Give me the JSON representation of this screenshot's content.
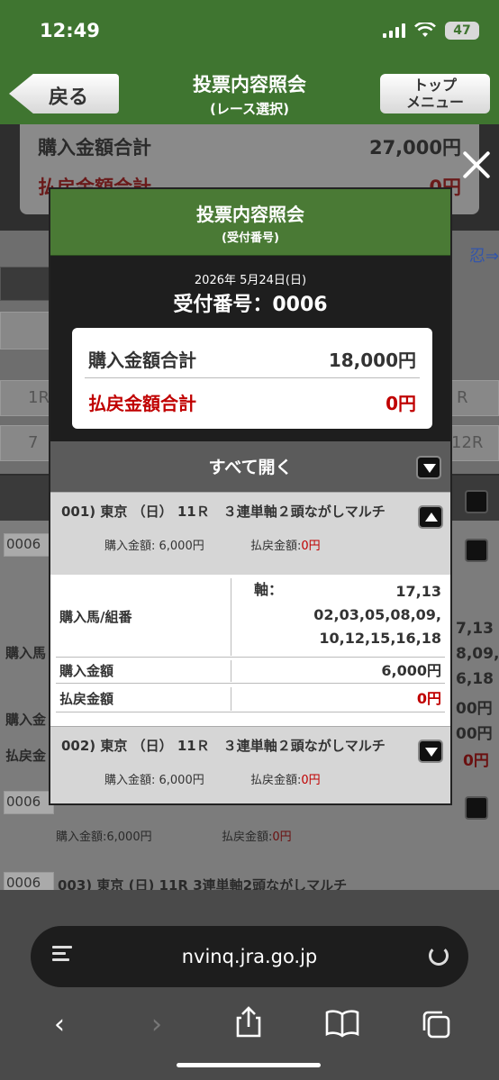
{
  "status": {
    "time": "12:49",
    "battery": "47"
  },
  "header": {
    "back_label": "戻る",
    "title": "投票内容照会",
    "subtitle": "(レース選択)",
    "top_line1": "トップ",
    "top_line2": "メニュー"
  },
  "background": {
    "purchase_label": "購入金額合計",
    "purchase_value": "27,000円",
    "refund_label": "払戻金額合計",
    "refund_value": "0円",
    "link_fragment": "忍⇒",
    "cell_1r": "1R",
    "cell_r": "R",
    "cell_7": "7",
    "cell_12r": "12R",
    "id1": "0006",
    "id2": "0006",
    "id3": "0006",
    "row_003": "003) 東京 (日) 11R 3連単軸2頭ながしマルチ",
    "sub_purchase": "購入金額:6,000円",
    "sub_refund_label": "払戻金額:",
    "sub_refund_value": "0円",
    "side1": "購入馬",
    "side2": "購入金",
    "side3": "払戻金",
    "right1": "7,13",
    "right2": "8,09,",
    "right3": "6,18",
    "right4": "00円",
    "right5": "00円",
    "right6": "0円"
  },
  "modal": {
    "title": "投票内容照会",
    "subtitle": "(受付番号)",
    "date": "2026年  5月24日(日)",
    "receipt_no": "受付番号：0006",
    "purchase_total_label": "購入金額合計",
    "purchase_total_value": "18,000円",
    "refund_total_label": "払戻金額合計",
    "refund_total_value": "0円",
    "open_all": "すべて開く",
    "items": [
      {
        "title": "001) 東京 （日） 11Ｒ　３連単軸２頭ながしマルチ",
        "purchase_label": "購入金額: 6,000円",
        "refund_label": "払戻金額:",
        "refund_value": "0円",
        "expanded": true,
        "detail": {
          "horse_label": "購入馬/組番",
          "axis_label": "軸：",
          "axis_value": "17,13",
          "combo_line1": "02,03,05,08,09,",
          "combo_line2": "10,12,15,16,18",
          "amount_label": "購入金額",
          "amount_value": "6,000円",
          "refund_label": "払戻金額",
          "refund_value": "0円"
        }
      },
      {
        "title": "002) 東京 （日） 11Ｒ　３連単軸２頭ながしマルチ",
        "purchase_label": "購入金額: 6,000円",
        "refund_label": "払戻金額:",
        "refund_value": "0円",
        "expanded": false
      }
    ]
  },
  "browser": {
    "url": "nvinq.jra.go.jp"
  },
  "icons": [
    "signal-icon",
    "wifi-icon",
    "battery-icon",
    "close-icon",
    "reader-icon",
    "reload-icon",
    "back-arrow-icon",
    "forward-arrow-icon",
    "share-icon",
    "bookmarks-icon",
    "tabs-icon"
  ]
}
